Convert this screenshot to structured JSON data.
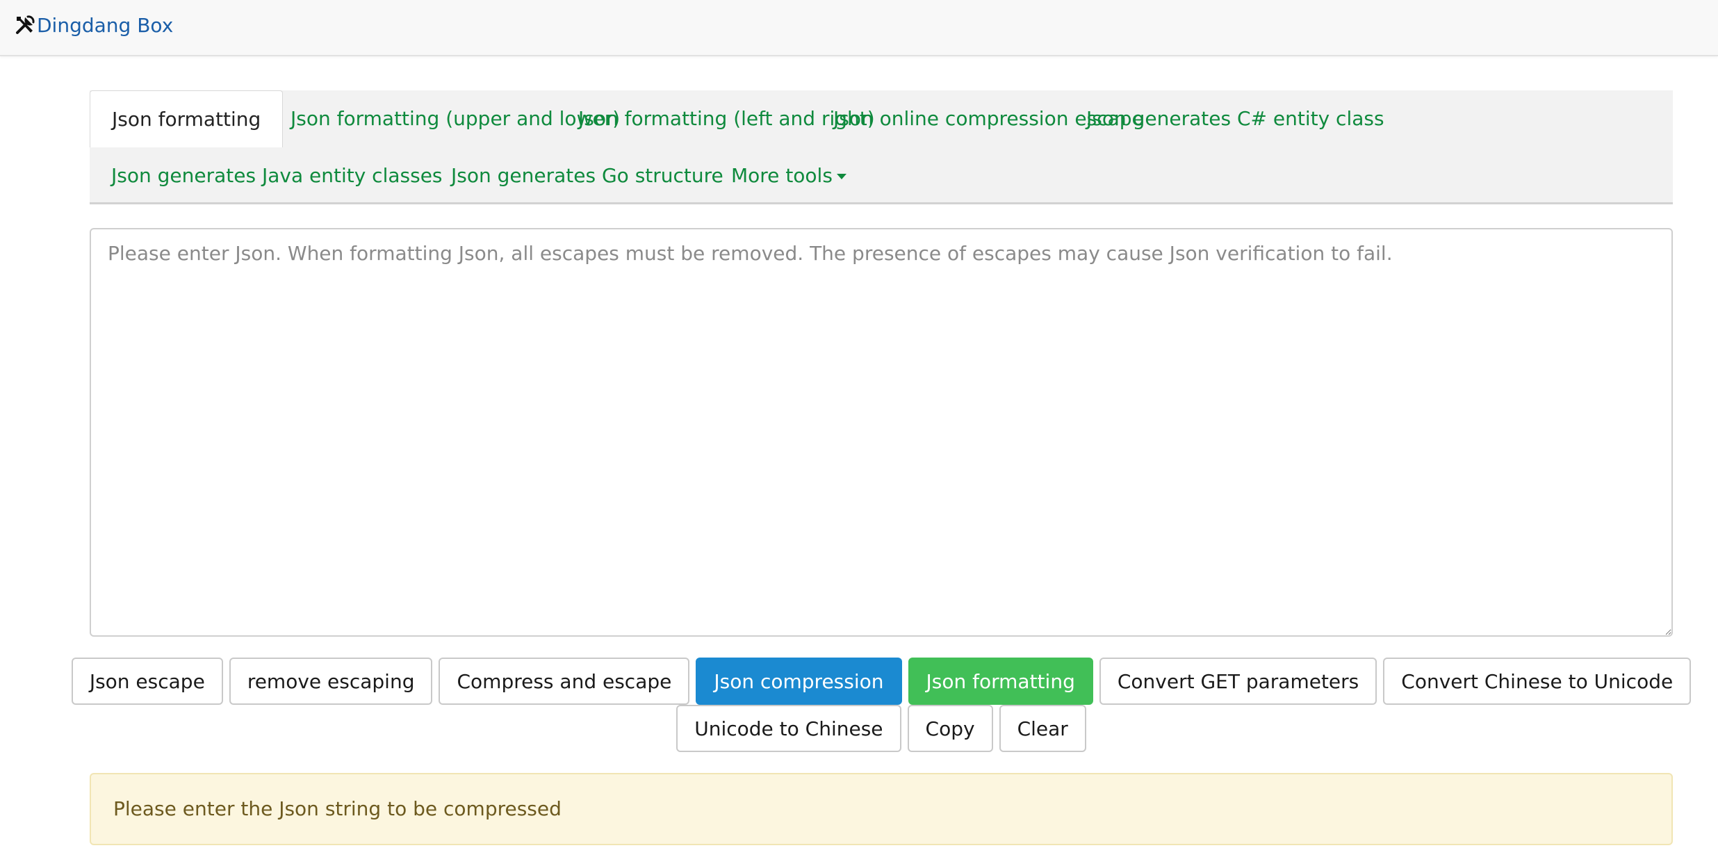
{
  "app": {
    "brand": "Dingdang Box",
    "brand_icon": "tools-icon",
    "brand_color": "#1a5ea8"
  },
  "tabs": {
    "items": [
      {
        "label": "Json formatting",
        "active": true
      },
      {
        "label": "Json formatting (upper and lower)"
      },
      {
        "label": "Json formatting (left and right)"
      },
      {
        "label": "Json online compression escape"
      },
      {
        "label": "Json generates C# entity class"
      },
      {
        "label": "Json generates Java entity classes"
      },
      {
        "label": "Json generates Go structure"
      },
      {
        "label": "More tools"
      }
    ],
    "link_color": "#0f8a3d"
  },
  "editor": {
    "value": "",
    "placeholder": "Please enter Json. When formatting Json, all escapes must be removed. The presence of escapes may cause Json verification to fail."
  },
  "buttons": {
    "json_escape": "Json escape",
    "remove_escaping": "remove escaping",
    "compress_and_escape": "Compress and escape",
    "json_compression": "Json compression",
    "json_formatting": "Json formatting",
    "convert_get_parameters": "Convert GET parameters",
    "convert_chinese_to_unicode": "Convert Chinese to Unicode",
    "unicode_to_chinese": "Unicode to Chinese",
    "copy": "Copy",
    "clear": "Clear",
    "primary_color": "#1b8ad1",
    "success_color": "#41bf57"
  },
  "alert": {
    "message": "Please enter the Json string to be compressed",
    "background": "#fcf6df"
  }
}
